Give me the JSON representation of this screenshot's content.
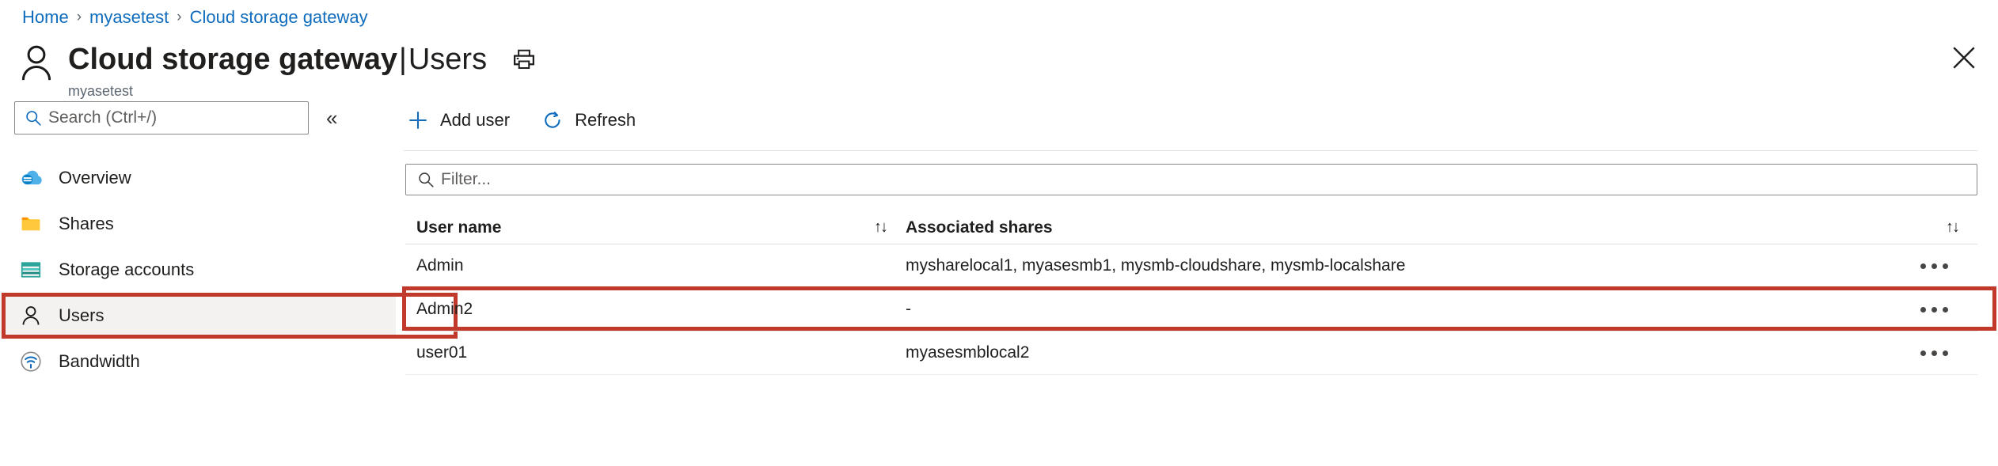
{
  "breadcrumb": {
    "items": [
      {
        "label": "Home"
      },
      {
        "label": "myasetest"
      },
      {
        "label": "Cloud storage gateway"
      }
    ],
    "separator": "›"
  },
  "header": {
    "icon": "user-icon",
    "title": "Cloud storage gateway",
    "separator": "|",
    "section": "Users",
    "subtitle": "myasetest",
    "print_icon": "printer-icon",
    "close_icon": "close-icon"
  },
  "sidebar": {
    "search": {
      "placeholder": "Search (Ctrl+/)",
      "value": "",
      "icon": "search-icon"
    },
    "collapse_label": "«",
    "items": [
      {
        "label": "Overview",
        "icon": "cloud-icon",
        "selected": false
      },
      {
        "label": "Shares",
        "icon": "folder-icon",
        "selected": false
      },
      {
        "label": "Storage accounts",
        "icon": "storage-account-icon",
        "selected": false
      },
      {
        "label": "Users",
        "icon": "user-icon",
        "selected": true
      },
      {
        "label": "Bandwidth",
        "icon": "bandwidth-icon",
        "selected": false
      }
    ]
  },
  "toolbar": {
    "add_user_label": "Add user",
    "add_user_icon": "plus-icon",
    "refresh_label": "Refresh",
    "refresh_icon": "refresh-icon"
  },
  "filter": {
    "placeholder": "Filter...",
    "value": "",
    "icon": "search-icon"
  },
  "table": {
    "columns": [
      {
        "label": "User name",
        "sort_icon": "sort-icon"
      },
      {
        "label": "Associated shares",
        "sort_icon": "sort-icon"
      }
    ],
    "rows": [
      {
        "user_name": "Admin",
        "associated_shares": "mysharelocal1, myasesmb1, mysmb-cloudshare, mysmb-localshare",
        "menu_icon": "more-icon",
        "highlighted": false
      },
      {
        "user_name": "Admin2",
        "associated_shares": "-",
        "menu_icon": "more-icon",
        "highlighted": true
      },
      {
        "user_name": "user01",
        "associated_shares": "myasesmblocal2",
        "menu_icon": "more-icon",
        "highlighted": false
      }
    ]
  },
  "colors": {
    "link": "#0f6cbd",
    "highlight_box": "#c0392b",
    "text": "#201f1e",
    "muted": "#5c6670",
    "selected_row_bg": "#f3f2f1"
  }
}
